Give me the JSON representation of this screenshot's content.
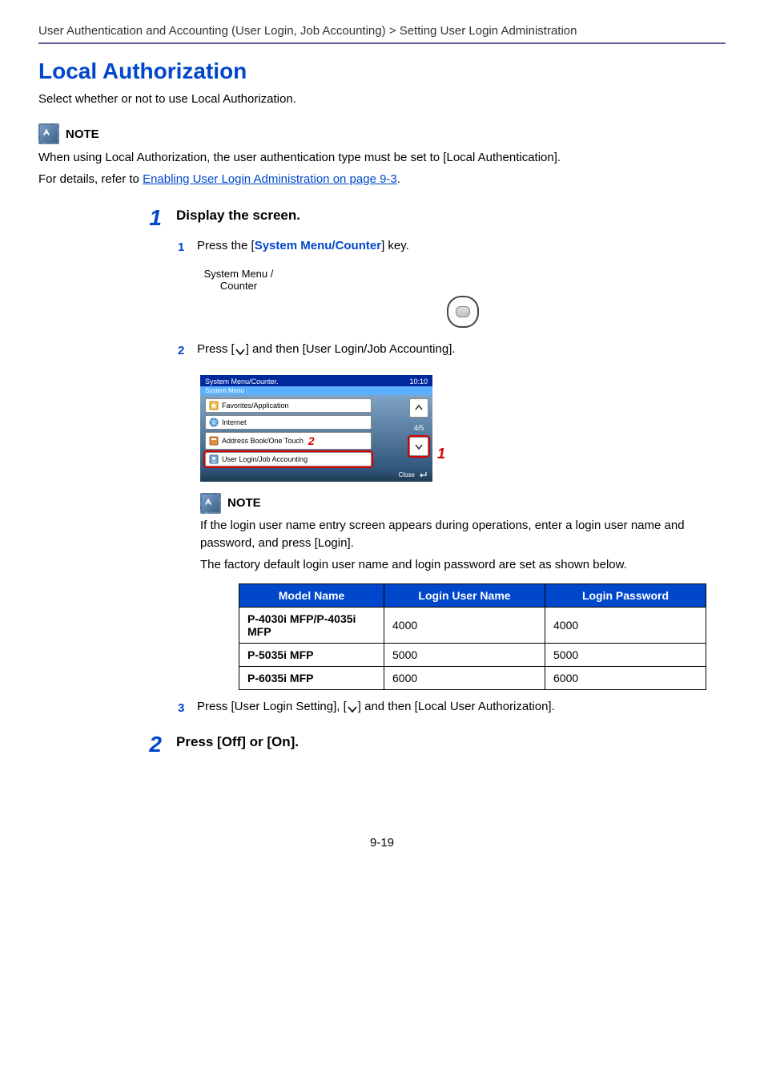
{
  "breadcrumb": "User Authentication and Accounting (User Login, Job Accounting) > Setting User Login Administration",
  "title": "Local Authorization",
  "intro": "Select whether or not to use Local Authorization.",
  "note_top": {
    "label": "NOTE",
    "line1": "When using Local Authorization, the user authentication type must be set to [Local Authentication].",
    "line2_pre": "For details, refer to ",
    "line2_link": "Enabling User Login Administration on page 9-3",
    "line2_post": "."
  },
  "step1": {
    "num": "1",
    "title": "Display the screen.",
    "sub1": {
      "num": "1",
      "pre": "Press the [",
      "key": "System Menu/Counter",
      "post": "] key."
    },
    "sysbtn_label_l1": "System Menu /",
    "sysbtn_label_l2": "Counter",
    "sub2": {
      "num": "2",
      "pre": "Press [",
      "post": "] and then [User Login/Job Accounting]."
    },
    "touchscreen": {
      "header_left": "System Menu/Counter.",
      "header_right": "10:10",
      "sub": "System Menu",
      "items": [
        "Favorites/Application",
        "Internet",
        "Address Book/One Touch",
        "User Login/Job Accounting"
      ],
      "page_indicator": "4/5",
      "close": "Close",
      "callout_right": "1",
      "callout_item3": "2"
    },
    "note_inner": {
      "label": "NOTE",
      "p1": "If the login user name entry screen appears during operations, enter a login user name and password, and press [Login].",
      "p2": "The factory default login user name and login password are set as shown below."
    },
    "table": {
      "headers": [
        "Model Name",
        "Login User Name",
        "Login Password"
      ],
      "rows": [
        [
          "P-4030i MFP/P-4035i MFP",
          "4000",
          "4000"
        ],
        [
          "P-5035i MFP",
          "5000",
          "5000"
        ],
        [
          "P-6035i MFP",
          "6000",
          "6000"
        ]
      ]
    },
    "sub3": {
      "num": "3",
      "pre": "Press [User Login Setting], [",
      "post": "] and then [Local User Authorization]."
    }
  },
  "step2": {
    "num": "2",
    "title": "Press [Off] or [On]."
  },
  "page_number": "9-19",
  "chart_data": {
    "type": "table",
    "title": "Factory default login credentials",
    "columns": [
      "Model Name",
      "Login User Name",
      "Login Password"
    ],
    "rows": [
      {
        "Model Name": "P-4030i MFP/P-4035i MFP",
        "Login User Name": "4000",
        "Login Password": "4000"
      },
      {
        "Model Name": "P-5035i MFP",
        "Login User Name": "5000",
        "Login Password": "5000"
      },
      {
        "Model Name": "P-6035i MFP",
        "Login User Name": "6000",
        "Login Password": "6000"
      }
    ]
  }
}
